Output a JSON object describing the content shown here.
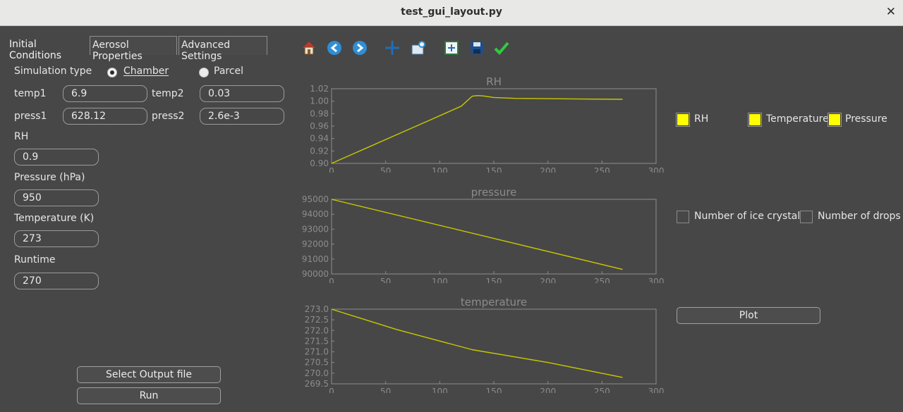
{
  "window": {
    "title": "test_gui_layout.py"
  },
  "tabs": [
    {
      "label": "Initial Conditions"
    },
    {
      "label": "Aerosol Properties"
    },
    {
      "label": "Advanced Settings"
    }
  ],
  "initial_conditions": {
    "simulation_type_label": "Simulation type",
    "sim_types": [
      {
        "label": "Chamber",
        "selected": true
      },
      {
        "label": "Parcel",
        "selected": false
      }
    ],
    "temp1_label": "temp1",
    "temp1_value": "6.9",
    "temp2_label": "temp2",
    "temp2_value": "0.03",
    "press1_label": "press1",
    "press1_value": "628.12",
    "press2_label": "press2",
    "press2_value": "2.6e-3",
    "rh_label": "RH",
    "rh_value": "0.9",
    "pressure_label": "Pressure (hPa)",
    "pressure_value": "950",
    "temperature_label": "Temperature (K)",
    "temperature_value": "273",
    "runtime_label": "Runtime",
    "runtime_value": "270"
  },
  "buttons": {
    "select_output": "Select Output file",
    "run": "Run",
    "plot": "Plot"
  },
  "toolbar": [
    {
      "icon": "home-icon"
    },
    {
      "icon": "back-arrow-icon"
    },
    {
      "icon": "forward-arrow-icon"
    },
    {
      "icon": "pan-icon"
    },
    {
      "icon": "zoom-icon"
    },
    {
      "icon": "subplots-icon"
    },
    {
      "icon": "save-icon"
    },
    {
      "icon": "check-icon"
    }
  ],
  "legend_checkboxes": [
    {
      "label": "RH",
      "checked": true
    },
    {
      "label": "Temperature",
      "checked": true
    },
    {
      "label": "Pressure",
      "checked": true
    }
  ],
  "count_checkboxes": [
    {
      "label": "Number of ice crystals",
      "checked": false
    },
    {
      "label": "Number of drops",
      "checked": false
    }
  ],
  "colors": {
    "line": "#c8c800",
    "axes": "#8c8c8c",
    "checked": "#ffff00",
    "background": "#474747"
  },
  "chart_data": [
    {
      "type": "line",
      "title": "RH",
      "xlim": [
        0,
        300
      ],
      "ylim": [
        0.9,
        1.02
      ],
      "xticks": [
        0,
        50,
        100,
        150,
        200,
        250,
        300
      ],
      "yticks": [
        "0.90",
        "0.92",
        "0.94",
        "0.96",
        "0.98",
        "1.00",
        "1.02"
      ],
      "x": [
        0,
        30,
        60,
        90,
        120,
        130,
        135,
        140,
        150,
        170,
        200,
        230,
        269
      ],
      "y": [
        0.9,
        0.923,
        0.946,
        0.969,
        0.992,
        1.008,
        1.009,
        1.0085,
        1.006,
        1.0045,
        1.004,
        1.0035,
        1.003
      ]
    },
    {
      "type": "line",
      "title": "pressure",
      "xlim": [
        0,
        300
      ],
      "ylim": [
        90000,
        95000
      ],
      "xticks": [
        0,
        50,
        100,
        150,
        200,
        250,
        300
      ],
      "yticks": [
        "90000",
        "91000",
        "92000",
        "93000",
        "94000",
        "95000"
      ],
      "x": [
        0,
        269
      ],
      "y": [
        95000,
        90300
      ]
    },
    {
      "type": "line",
      "title": "temperature",
      "xlim": [
        0,
        300
      ],
      "ylim": [
        269.5,
        273.0
      ],
      "xticks": [
        0,
        50,
        100,
        150,
        200,
        250,
        300
      ],
      "yticks": [
        "269.5",
        "270.0",
        "270.5",
        "271.0",
        "271.5",
        "272.0",
        "272.5",
        "273.0"
      ],
      "x": [
        0,
        60,
        130,
        200,
        269
      ],
      "y": [
        273.0,
        272.05,
        271.1,
        270.5,
        269.8
      ]
    }
  ]
}
